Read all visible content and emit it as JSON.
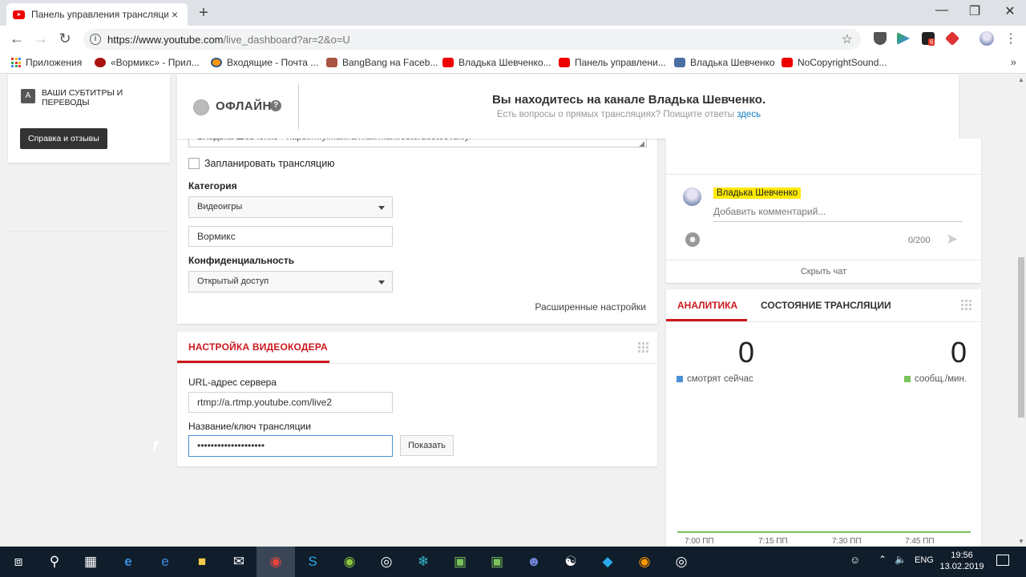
{
  "browser": {
    "tab_title": "Панель управления трансляци",
    "tab_close": "×",
    "new_tab": "+",
    "url_host": "https://www.youtube.com",
    "url_path": "/live_dashboard?ar=2&o=U",
    "bookmarks": [
      {
        "label": "Приложения",
        "icon": "apps-icon"
      },
      {
        "label": "«Вормикс» - Прил...",
        "icon": "wormix-icon"
      },
      {
        "label": "Входящие - Почта ...",
        "icon": "mail-icon"
      },
      {
        "label": "BangBang на Faceb...",
        "icon": "bangbang-icon"
      },
      {
        "label": "Владька Шевченко...",
        "icon": "youtube-icon"
      },
      {
        "label": "Панель управлени...",
        "icon": "youtube-icon"
      },
      {
        "label": "Владька Шевченко",
        "icon": "video-icon"
      },
      {
        "label": "NoCopyrightSound...",
        "icon": "youtube-icon"
      }
    ],
    "bookmarks_more": "»",
    "ext_badge": "6"
  },
  "sidebar": {
    "subtitles_label": "ВАШИ СУБТИТРЫ И ПЕРЕВОДЫ",
    "help_button": "Справка и отзывы"
  },
  "status": {
    "state": "ОФЛАЙН",
    "help": "?",
    "channel_message": "Вы находитесь на канале Владька Шевченко.",
    "faq_text": "Есть вопросы о прямых трансляциях? Поищите ответы ",
    "faq_link": "здесь"
  },
  "info": {
    "description_visible": "Владька Шевченко - https://my.mail.ru/mail/manifestordostoevskiy/",
    "schedule_label": "Запланировать трансляцию",
    "category_label": "Категория",
    "category_value": "Видеоигры",
    "game_value": "Вормикс",
    "privacy_label": "Конфиденциальность",
    "privacy_value": "Открытый доступ",
    "advanced_link": "Расширенные настройки"
  },
  "encoder": {
    "title": "НАСТРОЙКА ВИДЕОКОДЕРА",
    "server_label": "URL-адрес сервера",
    "server_value": "rtmp://a.rtmp.youtube.com/live2",
    "key_label": "Название/ключ трансляции",
    "key_value": "••••••••••••••••••••",
    "show_button": "Показать"
  },
  "chat": {
    "username": "Владька Шевченко",
    "comment_placeholder": "Добавить комментарий...",
    "char_count": "0/200",
    "hide_chat": "Скрыть чат"
  },
  "analytics": {
    "tabs": [
      "АНАЛИТИКА",
      "СОСТОЯНИЕ ТРАНСЛЯЦИИ"
    ],
    "viewers_value": "0",
    "viewers_label": "смотрят сейчас",
    "viewers_color": "#4a90d9",
    "messages_value": "0",
    "messages_label": "сообщ./мин.",
    "messages_color": "#7cc35b",
    "time_ticks": [
      "7:00 ПП",
      "7:15 ПП",
      "7:30 ПП",
      "7:45 ПП"
    ]
  },
  "taskbar": {
    "language": "ENG",
    "time": "19:56",
    "date": "13.02.2019"
  },
  "colors": {
    "accent": "#cc181e",
    "highlight": "#ffea00"
  }
}
